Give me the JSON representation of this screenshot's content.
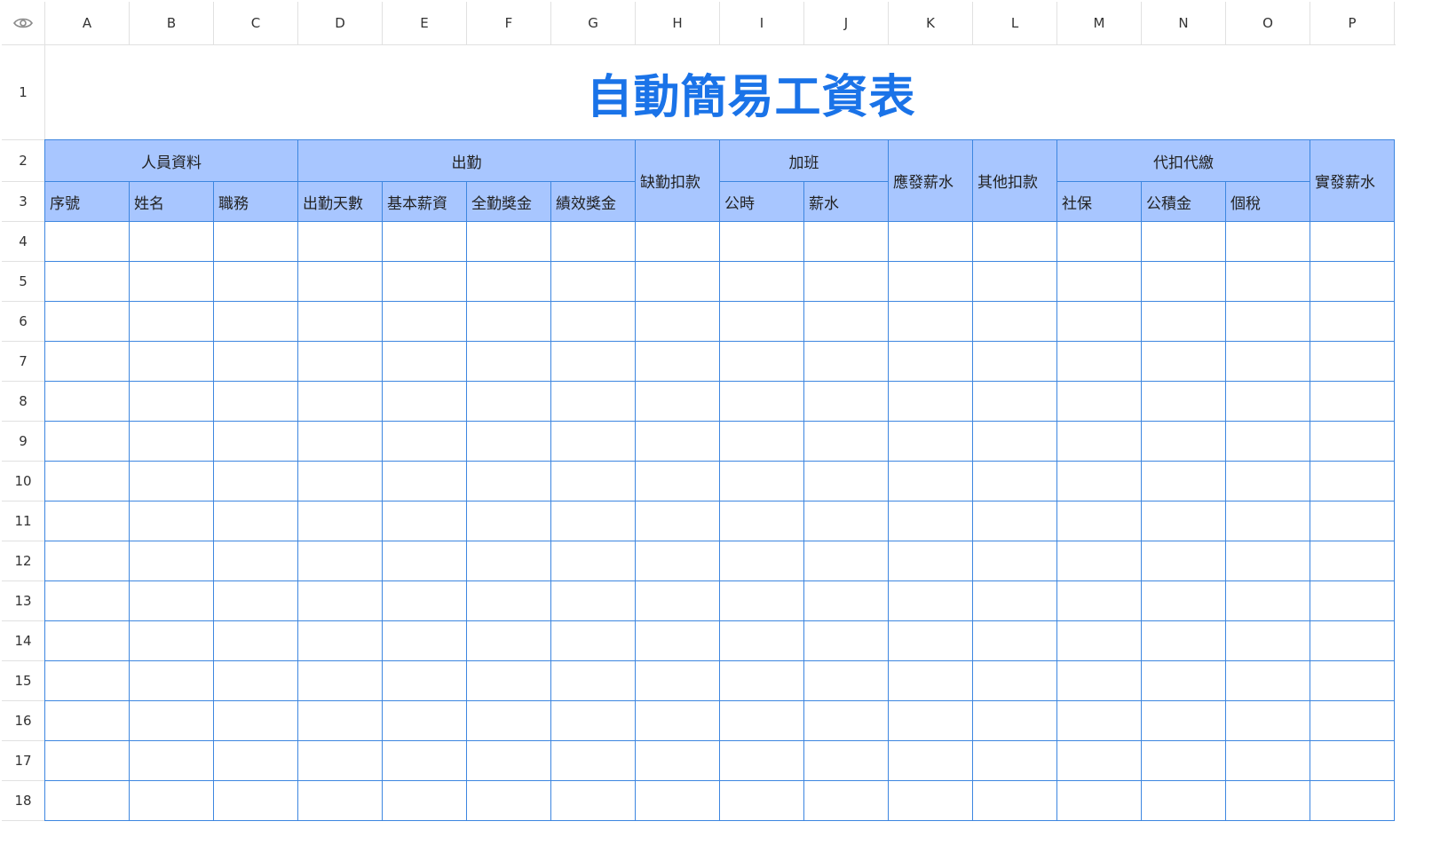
{
  "column_letters": [
    "A",
    "B",
    "C",
    "D",
    "E",
    "F",
    "G",
    "H",
    "I",
    "J",
    "K",
    "L",
    "M",
    "N",
    "O",
    "P"
  ],
  "row_numbers": [
    "1",
    "2",
    "3",
    "4",
    "5",
    "6",
    "7",
    "8",
    "9",
    "10",
    "11",
    "12",
    "13",
    "14",
    "15",
    "16",
    "17",
    "18"
  ],
  "title": "自動簡易工資表",
  "header_groups": {
    "personnel": "人員資料",
    "attendance": "出勤",
    "absence_deduction": "缺勤扣款",
    "overtime": "加班",
    "payable_salary": "應發薪水",
    "other_deduction": "其他扣款",
    "withholding": "代扣代繳",
    "net_salary": "實發薪水"
  },
  "sub_headers": {
    "serial": "序號",
    "name": "姓名",
    "position": "職務",
    "attendance_days": "出勤天數",
    "base_salary": "基本薪資",
    "full_attendance_bonus": "全勤獎金",
    "performance_bonus": "績效獎金",
    "ot_hours": "公時",
    "ot_pay": "薪水",
    "social_insurance": "社保",
    "housing_fund": "公積金",
    "income_tax": "個稅"
  },
  "colors": {
    "title": "#1a73e8",
    "header_fill": "#a8c6ff",
    "grid_line": "#3d86e0"
  }
}
